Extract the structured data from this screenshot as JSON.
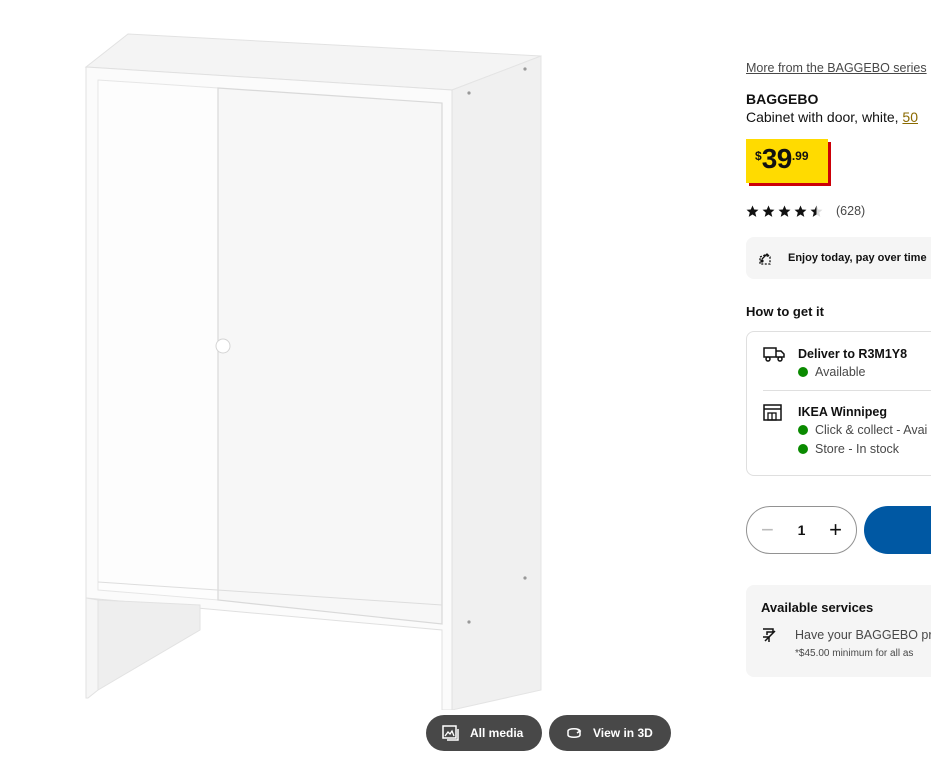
{
  "gallery": {
    "all_media_label": "All media",
    "view3d_label": "View in 3D"
  },
  "product": {
    "series_link": "More from the BAGGEBO series",
    "name": "BAGGEBO",
    "description_prefix": "Cabinet with door, white, ",
    "description_size": "50",
    "price": {
      "currency": "$",
      "whole": "39",
      "cents": ".99"
    },
    "rating": {
      "value": 4.5,
      "max": 5,
      "count": "(628)"
    }
  },
  "payment": {
    "label": "Enjoy today, pay over time"
  },
  "fulfillment": {
    "title": "How to get it",
    "delivery": {
      "title": "Deliver to R3M1Y8",
      "status": "Available"
    },
    "store": {
      "title": "IKEA Winnipeg",
      "click_collect": "Click & collect - Avai",
      "in_store": "Store - In stock"
    }
  },
  "cart": {
    "quantity": "1",
    "minus": "−",
    "plus": "+"
  },
  "services": {
    "title": "Available services",
    "assembly_text": "Have your BAGGEBO pr",
    "note": "*$45.00 minimum for all as"
  },
  "colors": {
    "price_yellow": "#ffdb00",
    "price_shadow": "#cc0008",
    "button_blue": "#0058a3",
    "available_green": "#0a8a00"
  },
  "icons": [
    "gallery-icon",
    "rotate-3d-icon",
    "star-icon",
    "payment-icon",
    "truck-icon",
    "store-icon",
    "assembly-icon"
  ]
}
